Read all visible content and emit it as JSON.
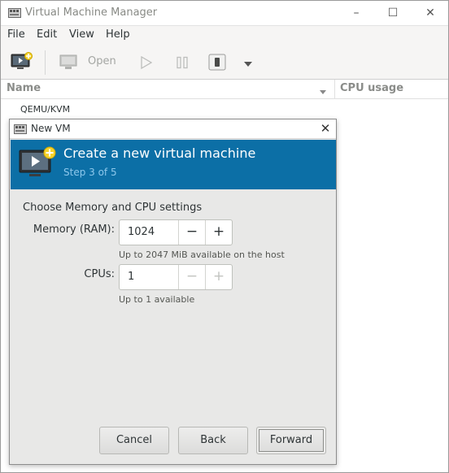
{
  "window": {
    "title": "Virtual Machine Manager",
    "controls": {
      "minimize": "–",
      "maximize": "☐",
      "close": "✕"
    }
  },
  "menu": [
    "File",
    "Edit",
    "View",
    "Help"
  ],
  "toolbar": {
    "open_label": "Open",
    "icons": [
      "new-vm-icon",
      "open-monitor-icon",
      "run-icon",
      "pause-icon",
      "shutdown-icon",
      "dropdown-arrow-icon"
    ]
  },
  "list": {
    "columns": [
      "Name",
      "CPU usage"
    ],
    "connection": "QEMU/KVM"
  },
  "dialog": {
    "title": "New VM",
    "close": "✕",
    "banner_title": "Create a new virtual machine",
    "step": "Step 3 of 5",
    "section_title": "Choose Memory and CPU settings",
    "memory": {
      "label": "Memory (RAM):",
      "value": "1024",
      "minus": "−",
      "plus": "+",
      "hint": "Up to 2047 MiB available on the host"
    },
    "cpus": {
      "label": "CPUs:",
      "value": "1",
      "minus": "−",
      "plus": "+",
      "hint": "Up to 1 available"
    },
    "buttons": {
      "cancel": "Cancel",
      "back": "Back",
      "forward": "Forward"
    }
  },
  "colors": {
    "banner": "#0c6fa6",
    "banner_step": "#8ec8ec",
    "dialog_bg": "#e8e8e7"
  }
}
